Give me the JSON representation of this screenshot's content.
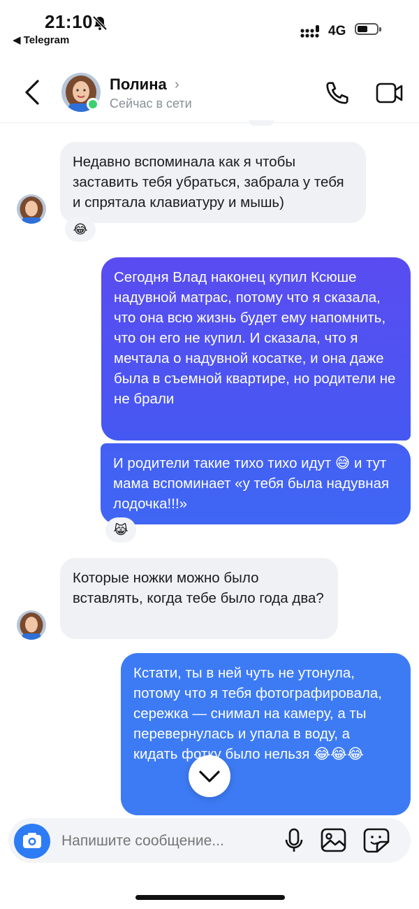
{
  "status_bar": {
    "time": "21:10",
    "back_app": "◀ Telegram",
    "network": "4G"
  },
  "header": {
    "name": "Полина",
    "status": "Сейчас в сети"
  },
  "messages": [
    {
      "side": "in",
      "text": "Недавно  вспоминала как я чтобы заставить тебя убраться, забрала у тебя и спрятала клавиатуру и мышь)",
      "reaction": "😂"
    },
    {
      "side": "out",
      "text": "Сегодня Влад наконец купил Ксюше надувной матрас, потому что я сказала, что она всю жизнь будет ему напомнить, что он его не купил. И сказала, что я мечтала о надувной косатке, и она даже была в съемной квартире, но родители не не брали"
    },
    {
      "side": "out",
      "text": "И родители такие тихо тихо идут 😅 и тут мама вспоминает «у тебя была надувная лодочка!!!»",
      "reaction": "😹"
    },
    {
      "side": "in",
      "text": "Которые ножки можно было вставлять, когда тебе было года два?"
    },
    {
      "side": "out",
      "text": "Кстати, ты в ней чуть не утонула, потому что я тебя фотографировала, сережка — снимал на камеру, а ты перевернулась и упала в воду, а кидать фотку было нельзя 😂😂😂"
    }
  ],
  "composer": {
    "placeholder": "Напишите сообщение..."
  },
  "colors": {
    "accent": "#2d7cf6",
    "out_gradient_top": "#5a4cf0",
    "out_gradient_bottom": "#3f63f3",
    "out_blue": "#3d7bf4",
    "incoming_bg": "#eff1f5",
    "online": "#3bd16f"
  }
}
